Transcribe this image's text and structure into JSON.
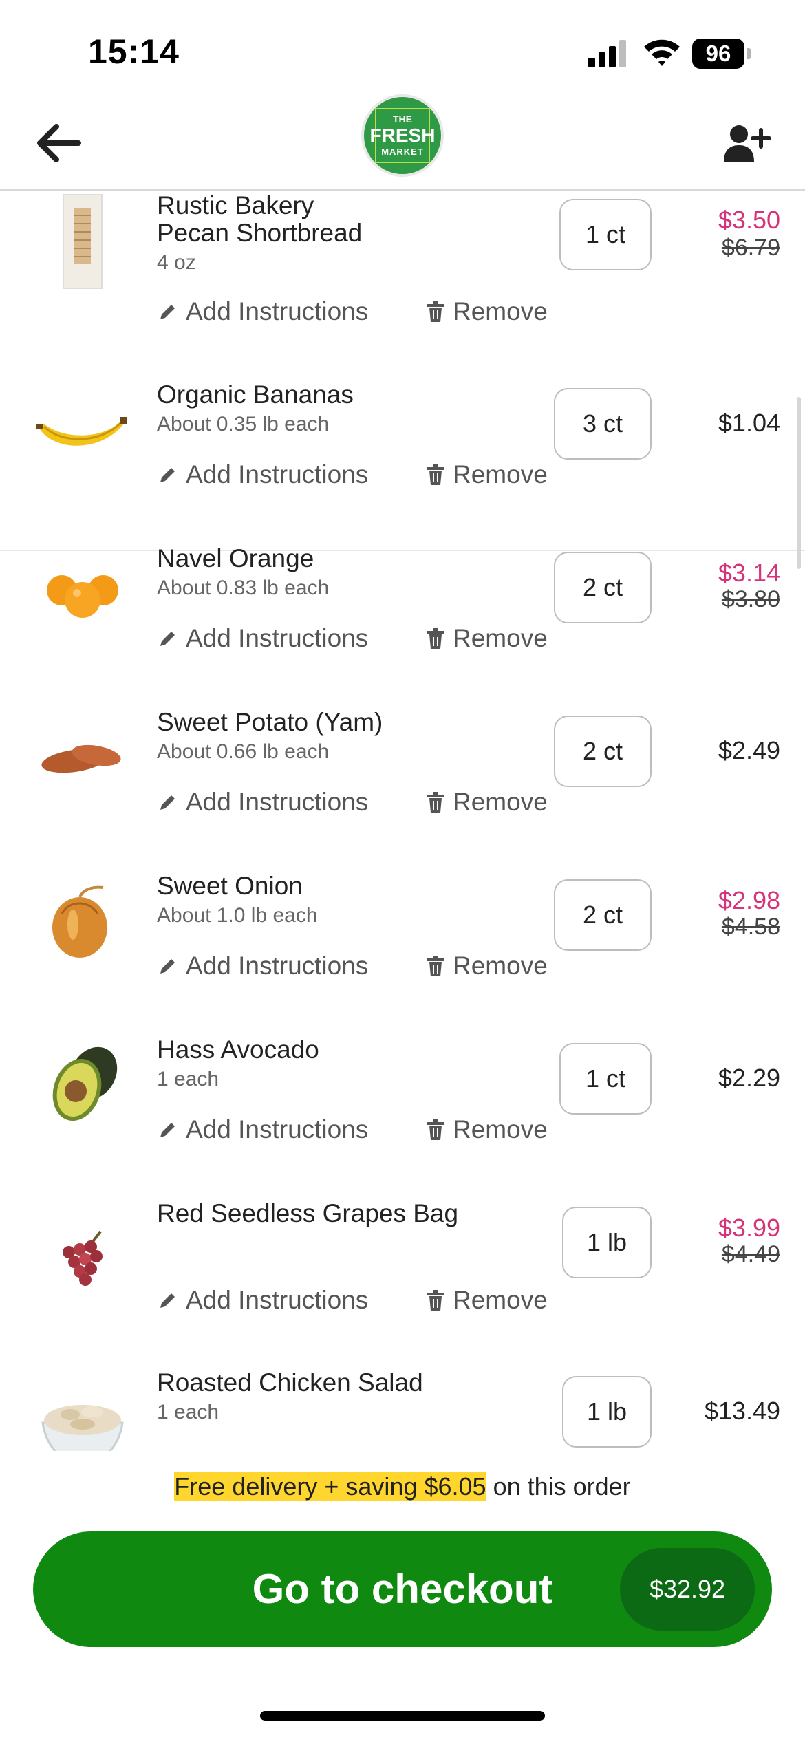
{
  "status_bar": {
    "time": "15:14",
    "battery": "96"
  },
  "header": {
    "logo": {
      "line1": "THE",
      "line2": "FRESH",
      "line3": "MARKET"
    },
    "colors": {
      "brand_green": "#2f9a45"
    }
  },
  "actions": {
    "add_instructions": "Add Instructions",
    "remove": "Remove"
  },
  "items": [
    {
      "name_line1": "Rustic Bakery",
      "name_line2": "Pecan Shortbread",
      "detail": "4 oz",
      "qty": "1 ct",
      "price": "$3.50",
      "old_price": "$6.79",
      "on_sale": true,
      "image_icon": "cookie-box-icon"
    },
    {
      "name_line1": "Organic Bananas",
      "detail": "About 0.35 lb each",
      "qty": "3 ct",
      "price": "$1.04",
      "on_sale": false,
      "image_icon": "banana-icon"
    },
    {
      "name_line1": "Navel Orange",
      "detail": "About 0.83 lb each",
      "qty": "2 ct",
      "price": "$3.14",
      "old_price": "$3.80",
      "on_sale": true,
      "image_icon": "orange-icon"
    },
    {
      "name_line1": "Sweet Potato (Yam)",
      "detail": "About 0.66 lb each",
      "qty": "2 ct",
      "price": "$2.49",
      "on_sale": false,
      "image_icon": "sweet-potato-icon"
    },
    {
      "name_line1": "Sweet Onion",
      "detail": "About 1.0 lb each",
      "qty": "2 ct",
      "price": "$2.98",
      "old_price": "$4.58",
      "on_sale": true,
      "image_icon": "onion-icon"
    },
    {
      "name_line1": "Hass Avocado",
      "detail": "1 each",
      "qty": "1 ct",
      "price": "$2.29",
      "on_sale": false,
      "image_icon": "avocado-icon"
    },
    {
      "name_line1": "Red Seedless Grapes Bag",
      "detail": "",
      "qty": "1 lb",
      "price": "$3.99",
      "old_price": "$4.49",
      "on_sale": true,
      "image_icon": "grapes-icon"
    },
    {
      "name_line1": "Roasted Chicken Salad",
      "detail": "1 each",
      "qty": "1 lb",
      "price": "$13.49",
      "on_sale": false,
      "image_icon": "chicken-salad-icon"
    }
  ],
  "footer": {
    "savings_highlight": "Free delivery + saving $6.05",
    "savings_suffix": " on this order",
    "checkout_label": "Go to checkout",
    "total": "$32.92"
  },
  "colors": {
    "sale_price": "#d6337a",
    "regular_price": "#222222",
    "checkout_green": "#108910",
    "highlight": "#ffd62e"
  }
}
